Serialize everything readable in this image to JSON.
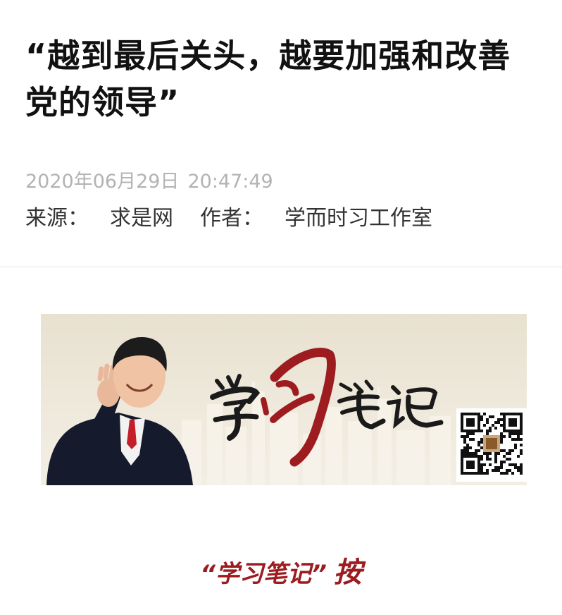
{
  "article": {
    "title": "“越到最后关头，越要加强和改善党的领导”",
    "date": "2020年06月29日",
    "time": "20:47:49",
    "source_label": "来源：",
    "source": "求是网",
    "author_label": "作者：",
    "author": "学而时习工作室"
  },
  "banner": {
    "calligraphy_text": "学习笔记",
    "qr_icon": "qr-code-icon",
    "colors": {
      "background": "#ece6d7",
      "calligraphy_black": "#1a1a1a",
      "calligraphy_red": "#9c1c20"
    }
  },
  "section": {
    "caption_quote": "“学习笔记”",
    "caption_suffix": "按",
    "color": "#9c1c20"
  }
}
